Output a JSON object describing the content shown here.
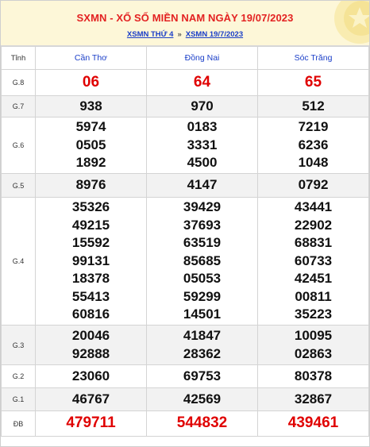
{
  "header": {
    "title": "SXMN - XỔ SỐ MIỀN NAM NGÀY 19/07/2023",
    "link1": "XSMN THỨ 4",
    "separator": "»",
    "link2": "XSMN 19/7/2023"
  },
  "table": {
    "columns": [
      "Tỉnh",
      "Cần Thơ",
      "Đồng Nai",
      "Sóc Trăng"
    ],
    "rows": [
      {
        "label": "G.8",
        "cells": [
          [
            "06"
          ],
          [
            "64"
          ],
          [
            "65"
          ]
        ]
      },
      {
        "label": "G.7",
        "cells": [
          [
            "938"
          ],
          [
            "970"
          ],
          [
            "512"
          ]
        ]
      },
      {
        "label": "G.6",
        "cells": [
          [
            "5974",
            "0505",
            "1892"
          ],
          [
            "0183",
            "3331",
            "4500"
          ],
          [
            "7219",
            "6236",
            "1048"
          ]
        ]
      },
      {
        "label": "G.5",
        "cells": [
          [
            "8976"
          ],
          [
            "4147"
          ],
          [
            "0792"
          ]
        ]
      },
      {
        "label": "G.4",
        "cells": [
          [
            "35326",
            "49215",
            "15592",
            "99131",
            "18378",
            "55413",
            "60816"
          ],
          [
            "39429",
            "37693",
            "63519",
            "85685",
            "05053",
            "59299",
            "14501"
          ],
          [
            "43441",
            "22902",
            "68831",
            "60733",
            "42451",
            "00811",
            "35223"
          ]
        ]
      },
      {
        "label": "G.3",
        "cells": [
          [
            "20046",
            "92888"
          ],
          [
            "41847",
            "28362"
          ],
          [
            "10095",
            "02863"
          ]
        ]
      },
      {
        "label": "G.2",
        "cells": [
          [
            "23060"
          ],
          [
            "69753"
          ],
          [
            "80378"
          ]
        ]
      },
      {
        "label": "G.1",
        "cells": [
          [
            "46767"
          ],
          [
            "42569"
          ],
          [
            "32867"
          ]
        ]
      },
      {
        "label": "ĐB",
        "cells": [
          [
            "479711"
          ],
          [
            "544832"
          ],
          [
            "439461"
          ]
        ]
      }
    ]
  },
  "colors": {
    "header_bg": "#fdf7d8",
    "title": "#e32222",
    "link": "#1a3ec8",
    "highlight_number": "#e00000",
    "alt_row": "#f2f2f2"
  },
  "icons": {
    "header_decoration": "star-icon"
  }
}
